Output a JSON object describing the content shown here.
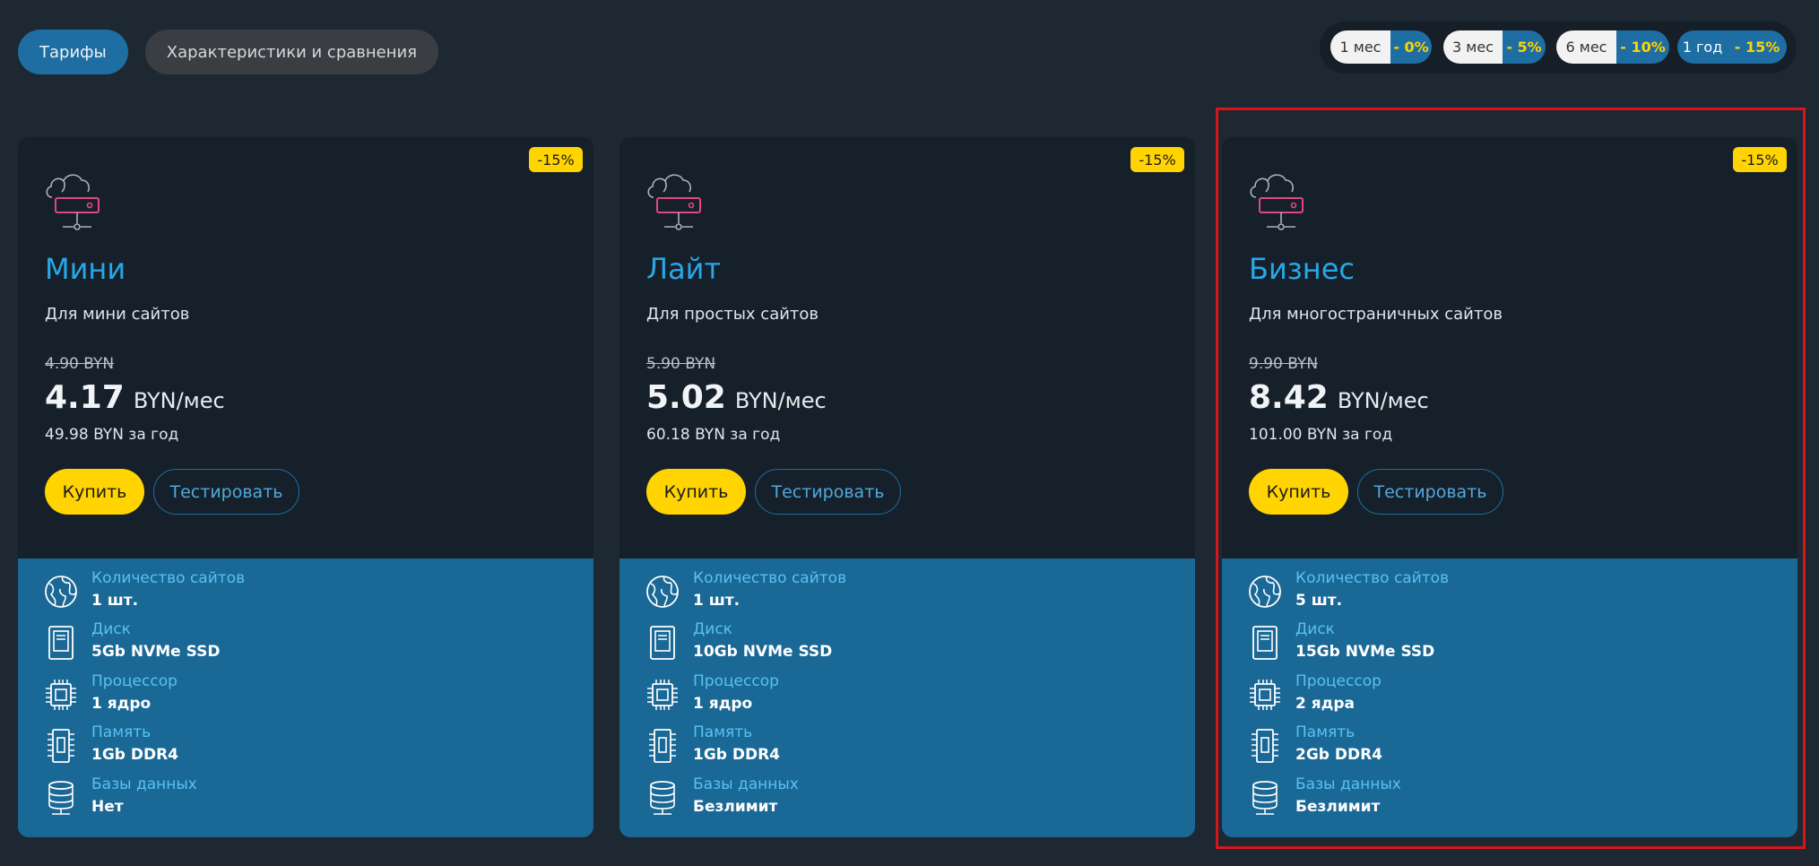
{
  "tabs": [
    {
      "label": "Тарифы",
      "active": true
    },
    {
      "label": "Характеристики и сравнения",
      "active": false
    }
  ],
  "periods": [
    {
      "label": "1 мес",
      "discount": "- 0%",
      "selected": false
    },
    {
      "label": "3 мес",
      "discount": "- 5%",
      "selected": false
    },
    {
      "label": "6 мес",
      "discount": "- 10%",
      "selected": false
    },
    {
      "label": "1 год",
      "discount": "- 15%",
      "selected": true
    }
  ],
  "colors": {
    "accent": "#1e6ea3",
    "highlight_yellow": "#ffd400",
    "plan_name": "#27a8e8",
    "annotation_box": "#d7151b"
  },
  "plans": [
    {
      "badge": "-15%",
      "name": "Мини",
      "desc": "Для мини сайтов",
      "old_price": "4.90 BYN",
      "price": "4.17",
      "unit": "BYN/мес",
      "yearly": "49.98 BYN за год",
      "buy_label": "Купить",
      "test_label": "Тестировать",
      "features": [
        {
          "icon": "globe-icon",
          "label": "Количество сайтов",
          "value": "1 шт."
        },
        {
          "icon": "disk-icon",
          "label": "Диск",
          "value": "5Gb NVMe SSD"
        },
        {
          "icon": "cpu-icon",
          "label": "Процессор",
          "value": "1 ядро"
        },
        {
          "icon": "memory-icon",
          "label": "Память",
          "value": "1Gb DDR4"
        },
        {
          "icon": "database-icon",
          "label": "Базы данных",
          "value": "Нет"
        }
      ]
    },
    {
      "badge": "-15%",
      "name": "Лайт",
      "desc": "Для простых сайтов",
      "old_price": "5.90 BYN",
      "price": "5.02",
      "unit": "BYN/мес",
      "yearly": "60.18 BYN за год",
      "buy_label": "Купить",
      "test_label": "Тестировать",
      "features": [
        {
          "icon": "globe-icon",
          "label": "Количество сайтов",
          "value": "1 шт."
        },
        {
          "icon": "disk-icon",
          "label": "Диск",
          "value": "10Gb NVMe SSD"
        },
        {
          "icon": "cpu-icon",
          "label": "Процессор",
          "value": "1 ядро"
        },
        {
          "icon": "memory-icon",
          "label": "Память",
          "value": "1Gb DDR4"
        },
        {
          "icon": "database-icon",
          "label": "Базы данных",
          "value": "Безлимит"
        }
      ]
    },
    {
      "badge": "-15%",
      "name": "Бизнес",
      "desc": "Для многостраничных сайтов",
      "old_price": "9.90 BYN",
      "price": "8.42",
      "unit": "BYN/мес",
      "yearly": "101.00 BYN за год",
      "buy_label": "Купить",
      "test_label": "Тестировать",
      "features": [
        {
          "icon": "globe-icon",
          "label": "Количество сайтов",
          "value": "5 шт."
        },
        {
          "icon": "disk-icon",
          "label": "Диск",
          "value": "15Gb NVMe SSD"
        },
        {
          "icon": "cpu-icon",
          "label": "Процессор",
          "value": "2 ядра"
        },
        {
          "icon": "memory-icon",
          "label": "Память",
          "value": "2Gb DDR4"
        },
        {
          "icon": "database-icon",
          "label": "Базы данных",
          "value": "Безлимит"
        }
      ]
    }
  ]
}
